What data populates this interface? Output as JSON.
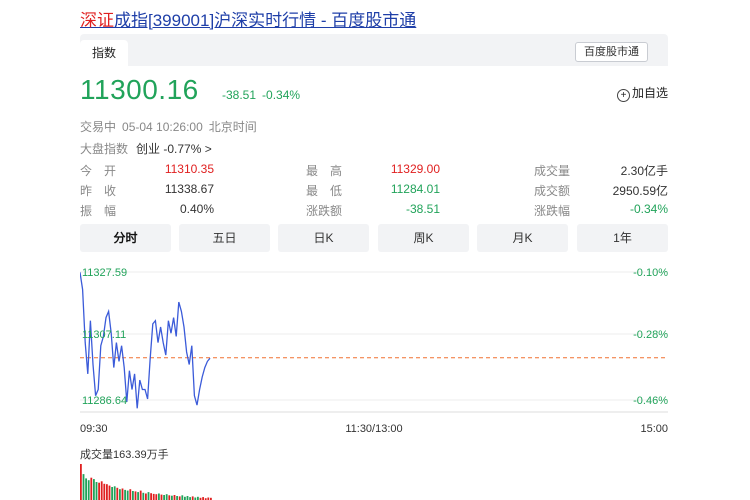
{
  "title": {
    "highlight": "深证",
    "rest": "成指[399001]沪深实时行情 - 百度股市通"
  },
  "tabs": {
    "active": "指数",
    "brand_button": "百度股市通"
  },
  "quote": {
    "price": "11300.16",
    "change": "-38.51",
    "change_pct": "-0.34%",
    "add_watch": "加自选",
    "add_watch_icon": "plus-circle-icon"
  },
  "status": {
    "state": "交易中",
    "datetime": "05-04 10:26:00",
    "timezone": "北京时间"
  },
  "market": {
    "label": "大盘指数",
    "item": "创业 -0.77%",
    "arrow": ">"
  },
  "stats": {
    "open_label": "今　开",
    "open": "11310.35",
    "prev_label": "昨　收",
    "prev": "11338.67",
    "amp_label": "振　幅",
    "amp": "0.40%",
    "high_label": "最　高",
    "high": "11329.00",
    "low_label": "最　低",
    "low": "11284.01",
    "chg_label": "涨跌额",
    "chg": "-38.51",
    "volume_label": "成交量",
    "volume": "2.30亿手",
    "turnover_label": "成交额",
    "turnover": "2950.59亿",
    "chgpct_label": "涨跌幅",
    "chgpct": "-0.34%"
  },
  "periods": [
    "分时",
    "五日",
    "日K",
    "周K",
    "月K",
    "1年"
  ],
  "active_period": "分时",
  "colors": {
    "up": "#e02020",
    "down": "#21a35a",
    "line": "#3b5bd9",
    "baseline": "#f07030",
    "link": "#1f3fa8"
  },
  "chart_data": {
    "type": "line",
    "y_ticks_left": [
      "11327.59",
      "11307.11",
      "11286.64"
    ],
    "y_ticks_right": [
      "-0.10%",
      "-0.28%",
      "-0.46%"
    ],
    "x_ticks": [
      "09:30",
      "11:30/13:00",
      "15:00"
    ],
    "ylim": [
      11286.64,
      11327.59
    ],
    "baseline": 11300.16,
    "series": [
      {
        "values": [
          11327.5,
          11322,
          11305,
          11295,
          11312,
          11298,
          11288,
          11290,
          11304,
          11307,
          11313,
          11315,
          11308,
          11297,
          11305,
          11299,
          11304,
          11297,
          11286,
          11296,
          11290,
          11295,
          11284,
          11293,
          11290,
          11290,
          11287,
          11300,
          11311,
          11312,
          11305,
          11310,
          11305,
          11301,
          11312,
          11308,
          11313,
          11307,
          11318,
          11315,
          11310,
          11302,
          11298,
          11304,
          11288,
          11285,
          11290,
          11294,
          11297,
          11299,
          11300
        ]
      }
    ],
    "volume_label": "成交量163.39万手",
    "volume": [
      100,
      72,
      60,
      55,
      62,
      58,
      50,
      48,
      52,
      45,
      44,
      40,
      36,
      38,
      34,
      30,
      32,
      28,
      26,
      30,
      25,
      24,
      22,
      26,
      20,
      18,
      22,
      19,
      17,
      16,
      18,
      15,
      14,
      16,
      13,
      12,
      14,
      11,
      10,
      13,
      9,
      11,
      8,
      10,
      7,
      9,
      6,
      8,
      5,
      7,
      6
    ]
  }
}
